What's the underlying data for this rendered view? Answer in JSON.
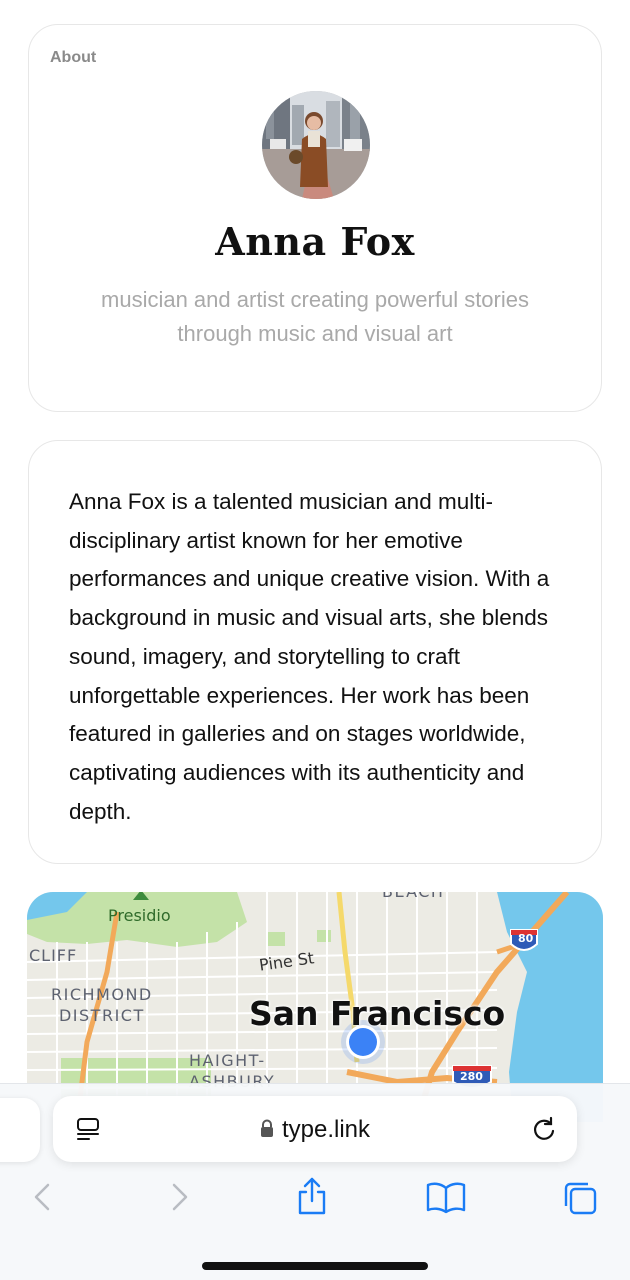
{
  "about": {
    "section_label": "About",
    "name": "Anna Fox",
    "tagline": "musician and artist creating powerful stories through music and visual art"
  },
  "bio": {
    "text": "Anna Fox is a talented musician and multi-disciplinary artist known for her emotive performances and unique creative vision. With a background in music and visual arts, she blends sound, imagery, and storytelling to craft unforgettable experiences. Her work has been featured in galleries and on stages worldwide, captivating audiences with its authenticity and depth."
  },
  "map": {
    "labels": {
      "presidio": "Presidio",
      "cliff": "CLIFF",
      "richmond": "RICHMOND",
      "district": "DISTRICT",
      "pine_st": "Pine St",
      "city": "San Francisco",
      "haight": "HAIGHT-",
      "ashbury": "ASHBURY",
      "beach": "BEACH",
      "highway_80": "80",
      "highway_280": "280"
    },
    "colors": {
      "water": "#74c7ec",
      "land": "#ecebe4",
      "park": "#c4e2a8",
      "freeway": "#f2a95a",
      "pin": "#3b82f6"
    }
  },
  "browser": {
    "url": "type.link",
    "icons": {
      "reader": "reader-mode-icon",
      "lock": "lock-icon",
      "reload": "reload-icon",
      "back": "back-icon",
      "forward": "forward-icon",
      "share": "share-icon",
      "bookmarks": "bookmarks-icon",
      "tabs": "tabs-icon"
    },
    "accent": "#1a7cf5"
  }
}
